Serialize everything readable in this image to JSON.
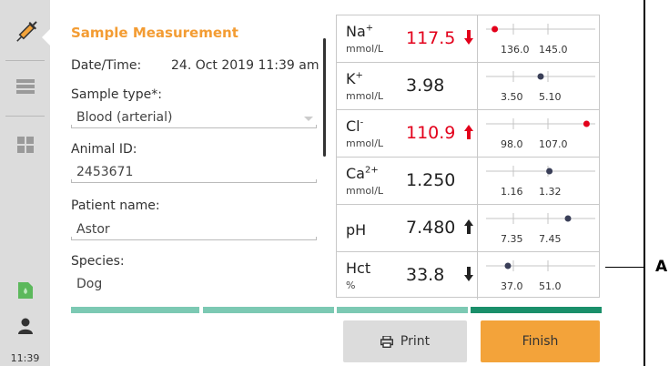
{
  "sidebar": {
    "time": "11:39",
    "items": [
      {
        "icon": "syringe-icon"
      },
      {
        "icon": "list-icon"
      },
      {
        "icon": "grid-icon"
      },
      {
        "icon": "cartridge-icon"
      },
      {
        "icon": "user-icon"
      }
    ]
  },
  "form": {
    "title": "Sample Measurement",
    "datetime_label": "Date/Time:",
    "datetime_value": "24. Oct 2019 11:39 am",
    "sample_type_label": "Sample type*:",
    "sample_type_value": "Blood (arterial)",
    "animal_id_label": "Animal ID:",
    "animal_id_value": "2453671",
    "patient_name_label": "Patient name:",
    "patient_name_value": "Astor",
    "species_label": "Species:",
    "species_value": "Dog"
  },
  "results": [
    {
      "param": "Na",
      "sup": "+",
      "unit": "mmol/L",
      "value": "117.5",
      "alarm": true,
      "trend": "down",
      "low": "136.0",
      "high": "145.0",
      "marker": 0.08
    },
    {
      "param": "K",
      "sup": "+",
      "unit": "mmol/L",
      "value": "3.98",
      "alarm": false,
      "trend": "none",
      "low": "3.50",
      "high": "5.10",
      "marker": 0.5
    },
    {
      "param": "Cl",
      "sup": "-",
      "unit": "mmol/L",
      "value": "110.9",
      "alarm": true,
      "trend": "up",
      "low": "98.0",
      "high": "107.0",
      "marker": 0.92
    },
    {
      "param": "Ca",
      "sup": "2+",
      "unit": "mmol/L",
      "value": "1.250",
      "alarm": false,
      "trend": "none",
      "low": "1.16",
      "high": "1.32",
      "marker": 0.58
    },
    {
      "param": "pH",
      "sup": "",
      "unit": "",
      "value": "7.480",
      "alarm": false,
      "trend": "up",
      "low": "7.35",
      "high": "7.45",
      "marker": 0.75
    },
    {
      "param": "Hct",
      "sup": "",
      "unit": "%",
      "value": "33.8",
      "alarm": false,
      "trend": "down",
      "low": "37.0",
      "high": "51.0",
      "marker": 0.2
    }
  ],
  "buttons": {
    "print": "Print",
    "finish": "Finish"
  },
  "callout": "A",
  "colors": {
    "accent": "#f39c33",
    "alarm": "#e3001b",
    "progress": "#7cc9b3",
    "progress_active": "#1a8f6a"
  }
}
